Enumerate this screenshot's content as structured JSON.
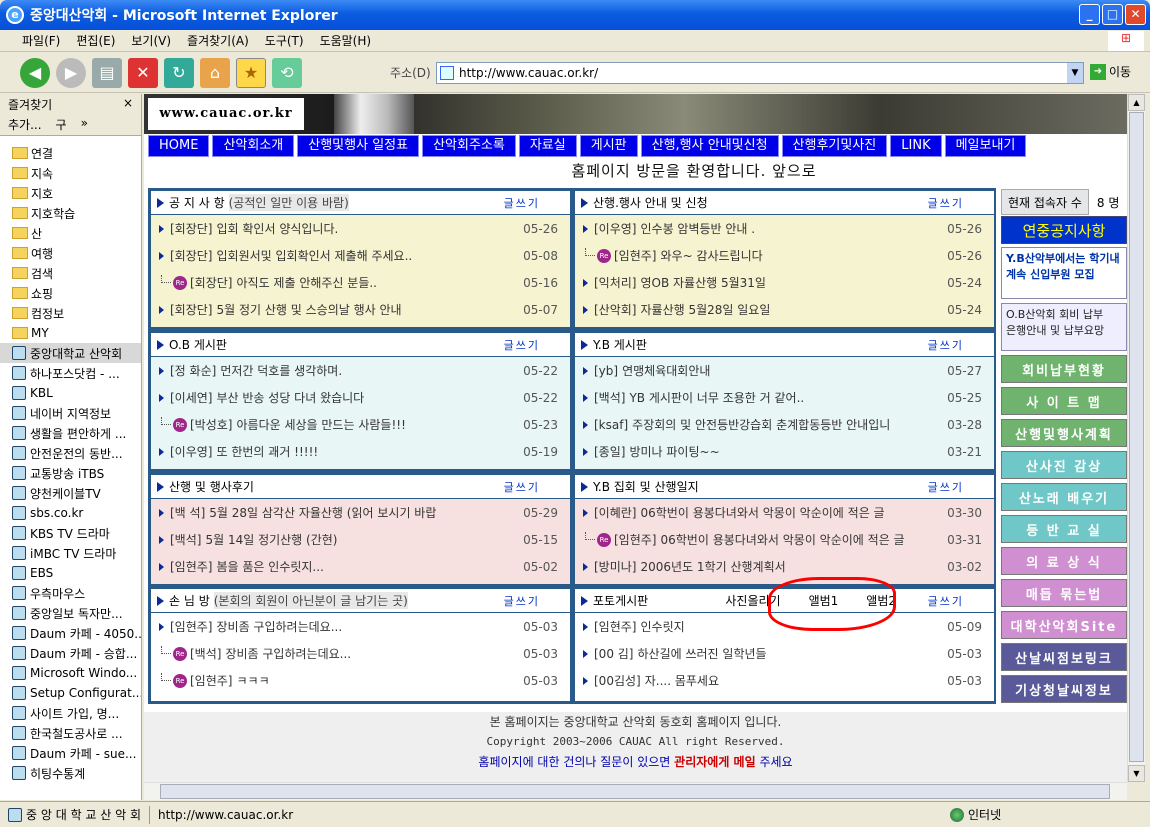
{
  "window": {
    "title": "중앙대산악회 - Microsoft Internet Explorer",
    "btn_min": "_",
    "btn_max": "□",
    "btn_close": "✕"
  },
  "menu": [
    "파일(F)",
    "편집(E)",
    "보기(V)",
    "즐겨찾기(A)",
    "도구(T)",
    "도움말(H)"
  ],
  "address": {
    "label": "주소(D)",
    "url": "http://www.cauac.or.kr/",
    "go": "이동"
  },
  "favorites": {
    "title": "즐겨찾기",
    "close": "×",
    "add": "추가...",
    "organize": "구",
    "more": "»",
    "items": [
      {
        "label": "연결",
        "type": "folder"
      },
      {
        "label": "지속",
        "type": "folder"
      },
      {
        "label": "지호",
        "type": "folder"
      },
      {
        "label": "지호학습",
        "type": "folder"
      },
      {
        "label": "산",
        "type": "folder"
      },
      {
        "label": "여행",
        "type": "folder"
      },
      {
        "label": "검색",
        "type": "folder"
      },
      {
        "label": "쇼핑",
        "type": "folder"
      },
      {
        "label": "컴정보",
        "type": "folder"
      },
      {
        "label": "MY",
        "type": "folder"
      },
      {
        "label": "중앙대학교 산악회",
        "type": "page"
      },
      {
        "label": "하나포스닷컴 - ...",
        "type": "page"
      },
      {
        "label": "KBL",
        "type": "page"
      },
      {
        "label": "네이버 지역정보",
        "type": "page"
      },
      {
        "label": "생활을 편안하게 ...",
        "type": "page"
      },
      {
        "label": "안전운전의 동반...",
        "type": "page"
      },
      {
        "label": "교통방송 iTBS",
        "type": "page"
      },
      {
        "label": "양천케이블TV",
        "type": "page"
      },
      {
        "label": "sbs.co.kr",
        "type": "page"
      },
      {
        "label": "KBS TV 드라마",
        "type": "page"
      },
      {
        "label": "iMBC TV 드라마",
        "type": "page"
      },
      {
        "label": "EBS",
        "type": "page"
      },
      {
        "label": "우측마우스",
        "type": "page"
      },
      {
        "label": "중앙일보 독자만...",
        "type": "page"
      },
      {
        "label": "Daum 카페 - 4050...",
        "type": "page"
      },
      {
        "label": "Daum 카페 - 승합...",
        "type": "page"
      },
      {
        "label": "Microsoft Windo...",
        "type": "page"
      },
      {
        "label": "Setup Configurat...",
        "type": "page"
      },
      {
        "label": "사이트 가입, 명...",
        "type": "page"
      },
      {
        "label": "한국철도공사로 ...",
        "type": "page"
      },
      {
        "label": "Daum 카페 - sue...",
        "type": "page"
      },
      {
        "label": "히팅수통계",
        "type": "page"
      }
    ]
  },
  "site": {
    "url_logo": "www.cauac.or.kr",
    "nav": [
      "HOME",
      "산악회소개",
      "산행및행사 일정표",
      "산악회주소록",
      "자료실",
      "게시판",
      "산행,행사 안내및신청",
      "산행후기및사진",
      "LINK",
      "메일보내기"
    ],
    "welcome": "홈페이지 방문을 환영합니다. 앞으로",
    "write_label": "글쓰기",
    "boards": [
      {
        "title": "공 지 사 항",
        "sub": "(공적인 일만 이용 바람)",
        "color": "yellow",
        "rows": [
          {
            "author": "[회장단]",
            "title": "입회 확인서 양식입니다.",
            "date": "05-26",
            "reply": false
          },
          {
            "author": "[회장단]",
            "title": "입회원서및 입회확인서 제출해 주세요..",
            "date": "05-08",
            "reply": false
          },
          {
            "author": "[회장단]",
            "title": "아직도 제출 안해주신 분들..",
            "date": "05-16",
            "reply": true
          },
          {
            "author": "[회장단]",
            "title": "5월 정기 산행 및 스승의날 행사 안내",
            "date": "05-07",
            "reply": false
          }
        ]
      },
      {
        "title": "산행.행사 안내 및 신청",
        "sub": "",
        "color": "yellow",
        "rows": [
          {
            "author": "[이우영]",
            "title": "인수봉 암벽등반 안내 .",
            "date": "05-26",
            "reply": false
          },
          {
            "author": "[임현주]",
            "title": "와우~ 감사드립니다",
            "date": "05-26",
            "reply": true
          },
          {
            "author": "[익처리]",
            "title": "영OB 자률산행 5월31일",
            "date": "05-24",
            "reply": false
          },
          {
            "author": "[산악회]",
            "title": "자률산행 5월28일 일요일",
            "date": "05-24",
            "reply": false
          }
        ]
      },
      {
        "title": "O.B 게시판",
        "sub": "",
        "color": "cyan",
        "rows": [
          {
            "author": "[정 화순]",
            "title": "먼저간 덕호를 생각하며.",
            "date": "05-22",
            "reply": false
          },
          {
            "author": "[이세연]",
            "title": "부산 반송 성당 다녀 왔습니다",
            "date": "05-22",
            "reply": false
          },
          {
            "author": "[박성호]",
            "title": "아름다운 세상을 만드는 사람들!!!",
            "date": "05-23",
            "reply": true
          },
          {
            "author": "[이우영]",
            "title": "또 한번의 괘거 !!!!!",
            "date": "05-19",
            "reply": false
          }
        ]
      },
      {
        "title": "Y.B 게시판",
        "sub": "",
        "color": "cyan",
        "rows": [
          {
            "author": "[yb]",
            "title": "연맹체육대회안내",
            "date": "05-27",
            "reply": false
          },
          {
            "author": "[백석]",
            "title": "YB 게시판이 너무 조용한 거 같어..",
            "date": "05-25",
            "reply": false
          },
          {
            "author": "[ksaf]",
            "title": "주장회의 및 안전등반강습회 춘계합동등반 안내입니",
            "date": "03-28",
            "reply": false
          },
          {
            "author": "[종일]",
            "title": "방미나 파이팅~~",
            "date": "03-21",
            "reply": false
          }
        ]
      },
      {
        "title": "산행 및 행사후기",
        "sub": "",
        "color": "pink",
        "rows": [
          {
            "author": "[백 석]",
            "title": "5월 28일 삼각산 자율산행 (읽어 보시기 바랍",
            "date": "05-29",
            "reply": false
          },
          {
            "author": "[백석]",
            "title": "5월 14일 정기산행 (간현)",
            "date": "05-15",
            "reply": false
          },
          {
            "author": "[임현주]",
            "title": "봄을 품은 인수릿지...",
            "date": "05-02",
            "reply": false
          }
        ]
      },
      {
        "title": "Y.B 집회 및 산행일지",
        "sub": "",
        "color": "pink",
        "rows": [
          {
            "author": "[이혜란]",
            "title": "06학번이 용봉다녀와서 악몽이 악순이에 적은 글",
            "date": "03-30",
            "reply": false
          },
          {
            "author": "[임현주]",
            "title": "06학번이 용봉다녀와서 악몽이 악순이에 적은 글",
            "date": "03-31",
            "reply": true
          },
          {
            "author": "[방미나]",
            "title": "2006년도 1학기 산행계획서",
            "date": "03-02",
            "reply": false
          }
        ]
      },
      {
        "title": "손 님 방",
        "sub": "(본회의 회원이 아닌분이 글 남기는 곳)",
        "color": "white",
        "rows": [
          {
            "author": "[임현주]",
            "title": "장비좀 구입하려는데요...",
            "date": "05-03",
            "reply": false
          },
          {
            "author": "[백석]",
            "title": "장비좀 구입하려는데요...",
            "date": "05-03",
            "reply": true
          },
          {
            "author": "[임현주]",
            "title": "ㅋㅋㅋ",
            "date": "05-03",
            "reply": true
          }
        ]
      },
      {
        "title": "포토게시판",
        "sub": "",
        "color": "white",
        "extra": [
          "사진올리기",
          "앨범1",
          "앨범2"
        ],
        "rows": [
          {
            "author": "[임현주]",
            "title": "인수릿지",
            "date": "05-09",
            "reply": false
          },
          {
            "author": "[00 김]",
            "title": "하산길에 쓰러진 일학년들",
            "date": "05-03",
            "reply": false
          },
          {
            "author": "[00김성]",
            "title": "자.... 몸푸세요",
            "date": "05-03",
            "reply": false
          }
        ]
      }
    ],
    "right": {
      "visitors_label": "현재 접속자 수",
      "visitors": "8 명",
      "notice": "연중공지사항",
      "box1": [
        "Y.B산악부에서는 학기내",
        "계속 신입부원 모집"
      ],
      "box2": [
        "O.B산악회 회비 납부",
        "은행안내 및 납부요망"
      ],
      "buttons": [
        {
          "label": "회비납부현황",
          "color": "#6fb36f"
        },
        {
          "label": "사 이 트 맵",
          "color": "#6fb36f"
        },
        {
          "label": "산행및행사계획",
          "color": "#6fb36f"
        },
        {
          "label": "산사진 감상",
          "color": "#6fc7c7"
        },
        {
          "label": "산노래 배우기",
          "color": "#6fc7c7"
        },
        {
          "label": "등 반 교 실",
          "color": "#6fc7c7"
        },
        {
          "label": "의 료 상 식",
          "color": "#d08fd0"
        },
        {
          "label": "매듭 묶는법",
          "color": "#d08fd0"
        },
        {
          "label": "대학산악회Site",
          "color": "#d08fd0"
        },
        {
          "label": "산날씨점보링크",
          "color": "#5a5a9a"
        },
        {
          "label": "기상청날씨정보",
          "color": "#5a5a9a"
        }
      ]
    },
    "footer": {
      "line1": "본 홈페이지는 중앙대학교 산악회 동호회 홈페이지 입니다.",
      "line2": "Copyright 2003~2006 CAUAC All right Reserved.",
      "line3a": "홈페이지에 대한 건의나 질문이 있으면",
      "admin": "관리자에게 메일",
      "line3b": "주세요"
    }
  },
  "status": {
    "text": "중 앙 대 학 교 산 악 회",
    "url": "http://www.cauac.or.kr",
    "zone": "인터넷"
  }
}
